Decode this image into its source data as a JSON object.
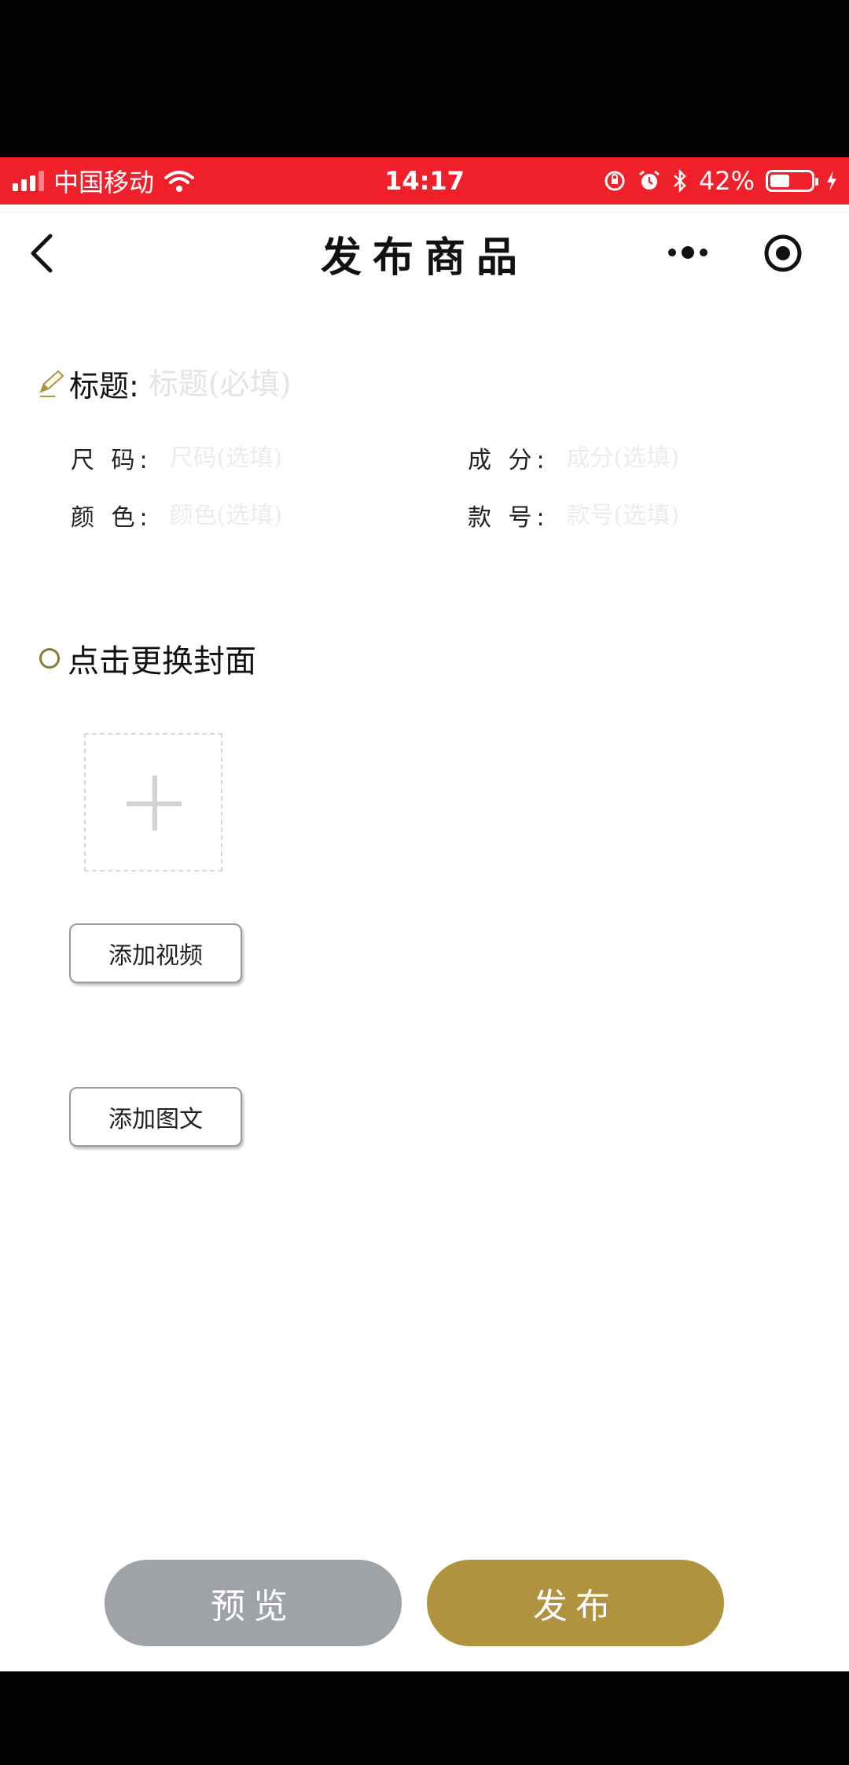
{
  "status_bar": {
    "carrier": "中国移动",
    "time": "14:17",
    "battery_percent": "42%",
    "battery_level": 0.42,
    "bg_color": "#f0202a"
  },
  "nav": {
    "title": "发布商品",
    "back_icon": "chevron-left-icon",
    "more_icon": "more-dots-icon",
    "target_icon": "target-icon"
  },
  "form": {
    "title_label": "标题:",
    "title_placeholder": "标题(必填)",
    "size_label": "尺 码:",
    "size_placeholder": "尺码(选填)",
    "composition_label": "成 分:",
    "composition_placeholder": "成分(选填)",
    "color_label": "颜 色:",
    "color_placeholder": "颜色(选填)",
    "style_no_label": "款 号:",
    "style_no_placeholder": "款号(选填)"
  },
  "cover": {
    "label": "点击更换封面"
  },
  "buttons": {
    "add_video": "添加视频",
    "add_rich_text": "添加图文",
    "preview": "预览",
    "publish": "发布"
  },
  "colors": {
    "accent_gold": "#b0933f",
    "preview_gray": "#9fa3a7"
  }
}
